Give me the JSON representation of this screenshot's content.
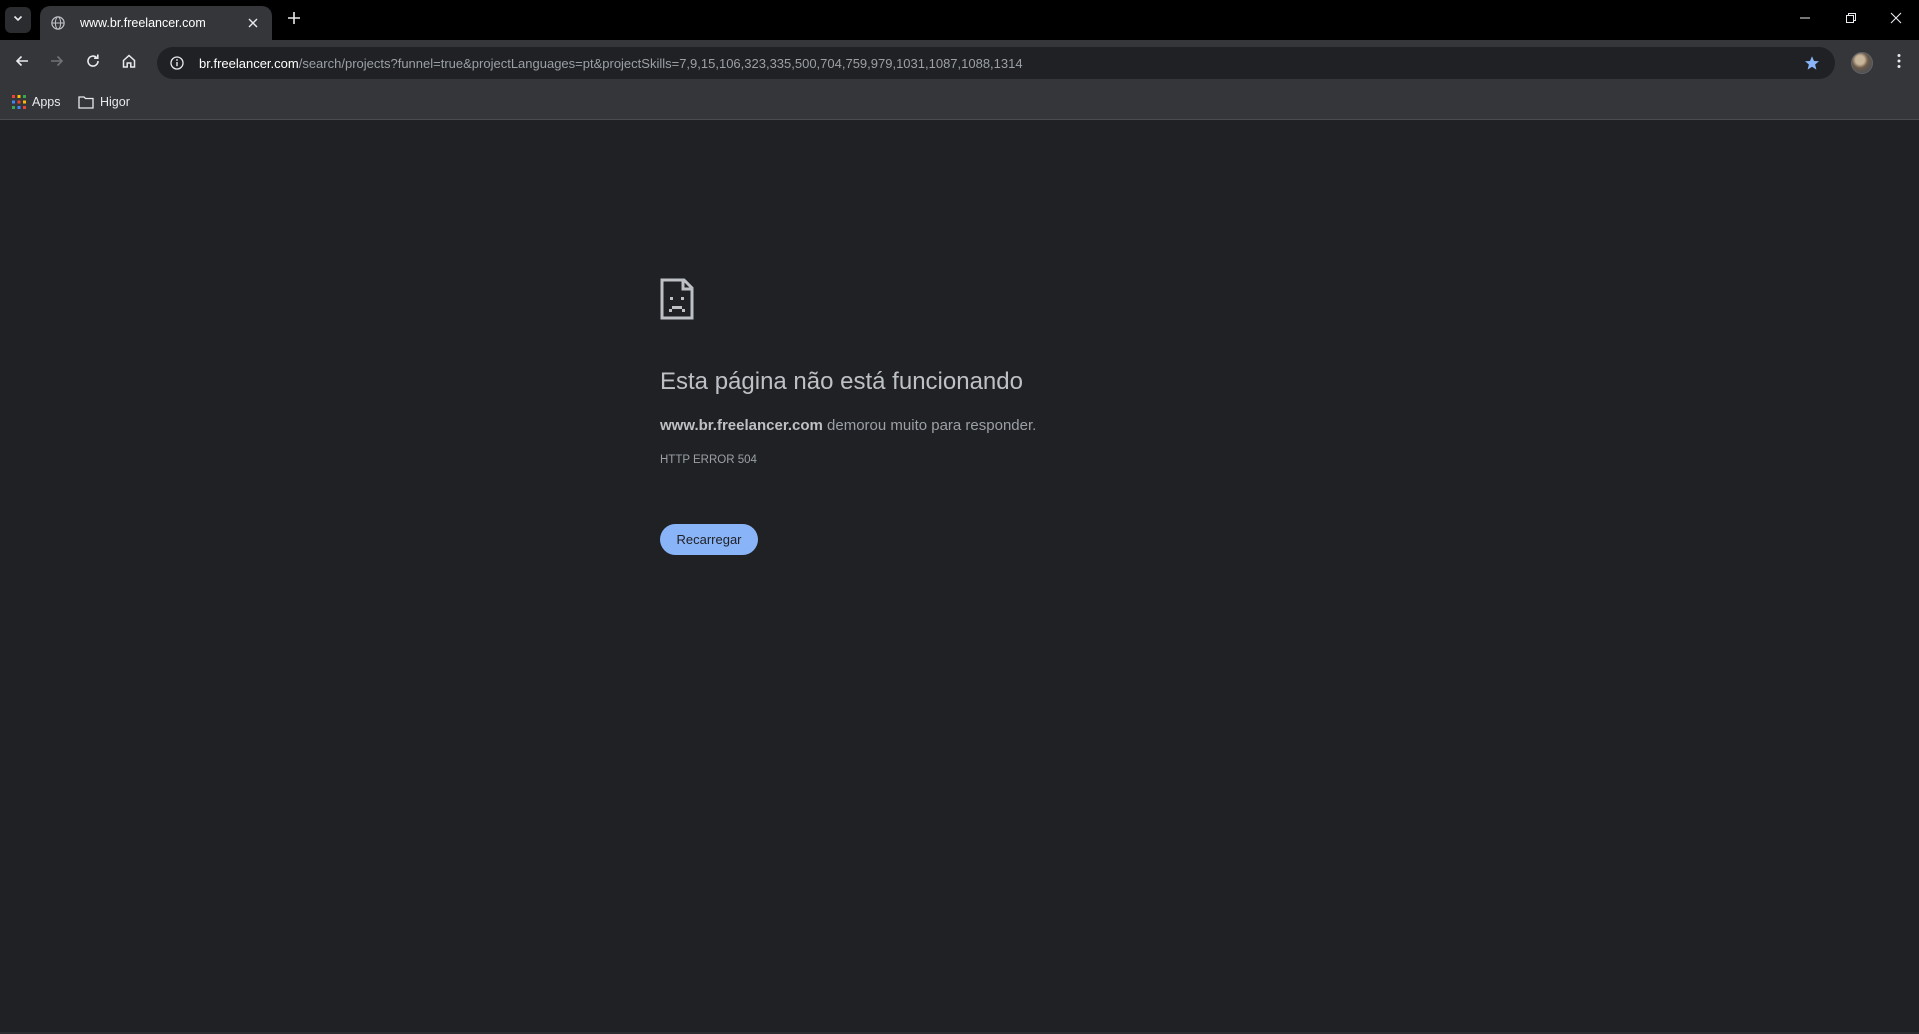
{
  "tab": {
    "title": "www.br.freelancer.com"
  },
  "address_bar": {
    "host": "br.freelancer.com",
    "path": "/search/projects?funnel=true&projectLanguages=pt&projectSkills=7,9,15,106,323,335,500,704,759,979,1031,1087,1088,1314"
  },
  "bookmarks": [
    {
      "label": "Apps",
      "icon": "apps-grid-icon"
    },
    {
      "label": "Higor",
      "icon": "folder-icon"
    }
  ],
  "error_page": {
    "heading": "Esta página não está funcionando",
    "host": "www.br.freelancer.com",
    "description_suffix": " demorou muito para responder.",
    "error_code": "HTTP ERROR 504",
    "reload_label": "Recarregar"
  },
  "colors": {
    "page_background": "#202124",
    "toolbar": "#35363a",
    "tabstrip": "#000000",
    "accent_button": "#8ab4f8",
    "bookmark_star": "#8ab4f8"
  }
}
